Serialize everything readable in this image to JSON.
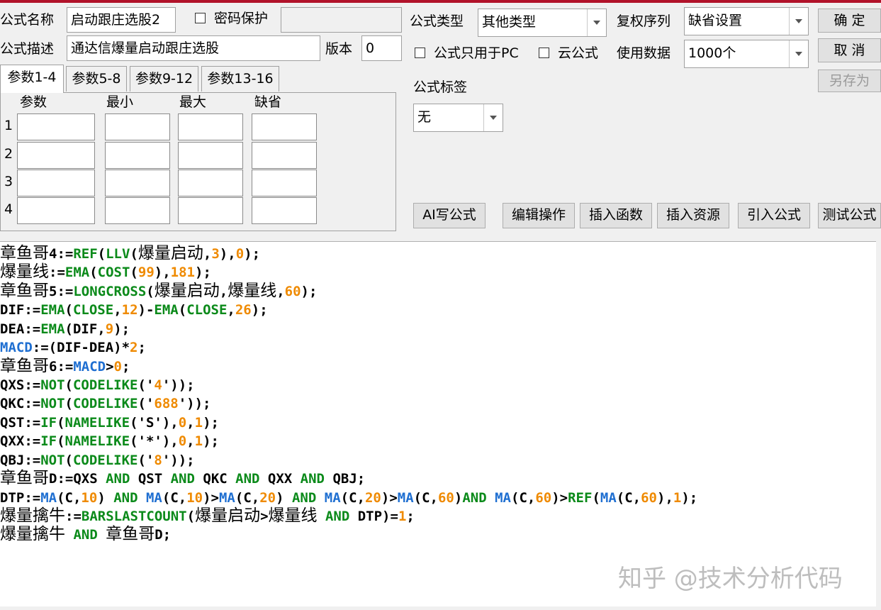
{
  "header": {
    "formula_name_label": "公式名称",
    "formula_name_value": "启动跟庄选股2",
    "password_label": "密码保护",
    "formula_desc_label": "公式描述",
    "formula_desc_value": "通达信爆量启动跟庄选股",
    "version_label": "版本",
    "version_value": "0",
    "formula_type_label": "公式类型",
    "formula_type_value": "其他类型",
    "rights_label": "复权序列",
    "rights_value": "缺省设置",
    "pc_only_label": "公式只用于PC",
    "cloud_label": "云公式",
    "data_label": "使用数据",
    "data_value": "1000个",
    "tag_label": "公式标签",
    "tag_value": "无"
  },
  "buttons": {
    "ok": "确  定",
    "cancel": "取  消",
    "save_as": "另存为",
    "ai": "AI写公式",
    "edit_ops": "编辑操作",
    "insert_func": "插入函数",
    "insert_res": "插入资源",
    "import_formula": "引入公式",
    "test_formula": "测试公式"
  },
  "tabs": [
    "参数1-4",
    "参数5-8",
    "参数9-12",
    "参数13-16"
  ],
  "params": {
    "headers": [
      "参数",
      "最小",
      "最大",
      "缺省"
    ],
    "rows": [
      "1",
      "2",
      "3",
      "4"
    ]
  },
  "code_lines": [
    [
      [
        "章鱼哥",
        "t"
      ],
      [
        "4:=",
        "k"
      ],
      [
        "REF",
        "g"
      ],
      [
        "(",
        "k"
      ],
      [
        "LLV",
        "g"
      ],
      [
        "(",
        "k"
      ],
      [
        "爆量启动",
        "t"
      ],
      [
        ",",
        "k"
      ],
      [
        "3",
        "o"
      ],
      [
        "),",
        "k"
      ],
      [
        "0",
        "o"
      ],
      [
        ");",
        "k"
      ]
    ],
    [
      [
        "爆量线",
        "t"
      ],
      [
        ":=",
        "k"
      ],
      [
        "EMA",
        "g"
      ],
      [
        "(",
        "k"
      ],
      [
        "COST",
        "g"
      ],
      [
        "(",
        "k"
      ],
      [
        "99",
        "o"
      ],
      [
        "),",
        "k"
      ],
      [
        "181",
        "o"
      ],
      [
        ");",
        "k"
      ]
    ],
    [
      [
        "章鱼哥",
        "t"
      ],
      [
        "5:=",
        "k"
      ],
      [
        "LONGCROSS",
        "g"
      ],
      [
        "(",
        "k"
      ],
      [
        "爆量启动",
        "t"
      ],
      [
        ",",
        "k"
      ],
      [
        "爆量线",
        "t"
      ],
      [
        ",",
        "k"
      ],
      [
        "60",
        "o"
      ],
      [
        ");",
        "k"
      ]
    ],
    [
      [
        "DIF:=",
        "k"
      ],
      [
        "EMA",
        "g"
      ],
      [
        "(",
        "k"
      ],
      [
        "CLOSE",
        "g"
      ],
      [
        ",",
        "k"
      ],
      [
        "12",
        "o"
      ],
      [
        ")-",
        "k"
      ],
      [
        "EMA",
        "g"
      ],
      [
        "(",
        "k"
      ],
      [
        "CLOSE",
        "g"
      ],
      [
        ",",
        "k"
      ],
      [
        "26",
        "o"
      ],
      [
        ");",
        "k"
      ]
    ],
    [
      [
        "DEA:=",
        "k"
      ],
      [
        "EMA",
        "g"
      ],
      [
        "(DIF,",
        "k"
      ],
      [
        "9",
        "o"
      ],
      [
        ");",
        "k"
      ]
    ],
    [
      [
        "MACD",
        "b"
      ],
      [
        ":=(DIF-DEA)*",
        "k"
      ],
      [
        "2",
        "o"
      ],
      [
        ";",
        "k"
      ]
    ],
    [
      [
        "章鱼哥",
        "t"
      ],
      [
        "6:=",
        "k"
      ],
      [
        "MACD",
        "b"
      ],
      [
        ">",
        "k"
      ],
      [
        "0",
        "o"
      ],
      [
        ";",
        "k"
      ]
    ],
    [
      [
        "QXS:=",
        "k"
      ],
      [
        "NOT",
        "g"
      ],
      [
        "(",
        "k"
      ],
      [
        "CODELIKE",
        "g"
      ],
      [
        "('",
        "k"
      ],
      [
        "4",
        "o"
      ],
      [
        "'));",
        "k"
      ]
    ],
    [
      [
        "QKC:=",
        "k"
      ],
      [
        "NOT",
        "g"
      ],
      [
        "(",
        "k"
      ],
      [
        "CODELIKE",
        "g"
      ],
      [
        "('",
        "k"
      ],
      [
        "688",
        "o"
      ],
      [
        "'));",
        "k"
      ]
    ],
    [
      [
        "QST:=",
        "k"
      ],
      [
        "IF",
        "g"
      ],
      [
        "(",
        "k"
      ],
      [
        "NAMELIKE",
        "g"
      ],
      [
        "('S'),",
        "k"
      ],
      [
        "0",
        "o"
      ],
      [
        ",",
        "k"
      ],
      [
        "1",
        "o"
      ],
      [
        ");",
        "k"
      ]
    ],
    [
      [
        "QXX:=",
        "k"
      ],
      [
        "IF",
        "g"
      ],
      [
        "(",
        "k"
      ],
      [
        "NAMELIKE",
        "g"
      ],
      [
        "('*'),",
        "k"
      ],
      [
        "0",
        "o"
      ],
      [
        ",",
        "k"
      ],
      [
        "1",
        "o"
      ],
      [
        ");",
        "k"
      ]
    ],
    [
      [
        "QBJ:=",
        "k"
      ],
      [
        "NOT",
        "g"
      ],
      [
        "(",
        "k"
      ],
      [
        "CODELIKE",
        "g"
      ],
      [
        "('",
        "k"
      ],
      [
        "8",
        "o"
      ],
      [
        "'));",
        "k"
      ]
    ],
    [
      [
        "章鱼哥",
        "t"
      ],
      [
        "D:=QXS ",
        "k"
      ],
      [
        "AND",
        "g"
      ],
      [
        " QST ",
        "k"
      ],
      [
        "AND",
        "g"
      ],
      [
        " QKC ",
        "k"
      ],
      [
        "AND",
        "g"
      ],
      [
        " QXX ",
        "k"
      ],
      [
        "AND",
        "g"
      ],
      [
        " QBJ;",
        "k"
      ]
    ],
    [
      [
        "DTP:=",
        "k"
      ],
      [
        "MA",
        "b"
      ],
      [
        "(C,",
        "k"
      ],
      [
        "10",
        "o"
      ],
      [
        ") ",
        "k"
      ],
      [
        "AND",
        "g"
      ],
      [
        " ",
        "k"
      ],
      [
        "MA",
        "b"
      ],
      [
        "(C,",
        "k"
      ],
      [
        "10",
        "o"
      ],
      [
        ")>",
        "k"
      ],
      [
        "MA",
        "b"
      ],
      [
        "(C,",
        "k"
      ],
      [
        "20",
        "o"
      ],
      [
        ") ",
        "k"
      ],
      [
        "AND",
        "g"
      ],
      [
        " ",
        "k"
      ],
      [
        "MA",
        "b"
      ],
      [
        "(C,",
        "k"
      ],
      [
        "20",
        "o"
      ],
      [
        ")>",
        "k"
      ],
      [
        "MA",
        "b"
      ],
      [
        "(C,",
        "k"
      ],
      [
        "60",
        "o"
      ],
      [
        ")",
        "k"
      ],
      [
        "AND",
        "g"
      ],
      [
        " ",
        "k"
      ],
      [
        "MA",
        "b"
      ],
      [
        "(C,",
        "k"
      ],
      [
        "60",
        "o"
      ],
      [
        ")>",
        "k"
      ],
      [
        "REF",
        "g"
      ],
      [
        "(",
        "k"
      ],
      [
        "MA",
        "b"
      ],
      [
        "(C,",
        "k"
      ],
      [
        "60",
        "o"
      ],
      [
        "),",
        "k"
      ],
      [
        "1",
        "o"
      ],
      [
        ");",
        "k"
      ]
    ],
    [
      [
        "爆量擒牛",
        "t"
      ],
      [
        ":=",
        "k"
      ],
      [
        "BARSLASTCOUNT",
        "g"
      ],
      [
        "(",
        "k"
      ],
      [
        "爆量启动",
        "t"
      ],
      [
        ">",
        "k"
      ],
      [
        "爆量线",
        "t"
      ],
      [
        " ",
        "k"
      ],
      [
        "AND",
        "g"
      ],
      [
        " DTP)=",
        "k"
      ],
      [
        "1",
        "o"
      ],
      [
        ";",
        "k"
      ]
    ],
    [
      [
        "爆量擒牛",
        "t"
      ],
      [
        " ",
        "k"
      ],
      [
        "AND",
        "g"
      ],
      [
        " ",
        "k"
      ],
      [
        "章鱼哥",
        "t"
      ],
      [
        "D;",
        "k"
      ]
    ]
  ],
  "watermark": "知乎 @技术分析代码",
  "colors": {
    "function": "#0b8a1a",
    "number": "#ef8a00",
    "indicator": "#1f6fd1",
    "top_border": "#b1122a"
  }
}
